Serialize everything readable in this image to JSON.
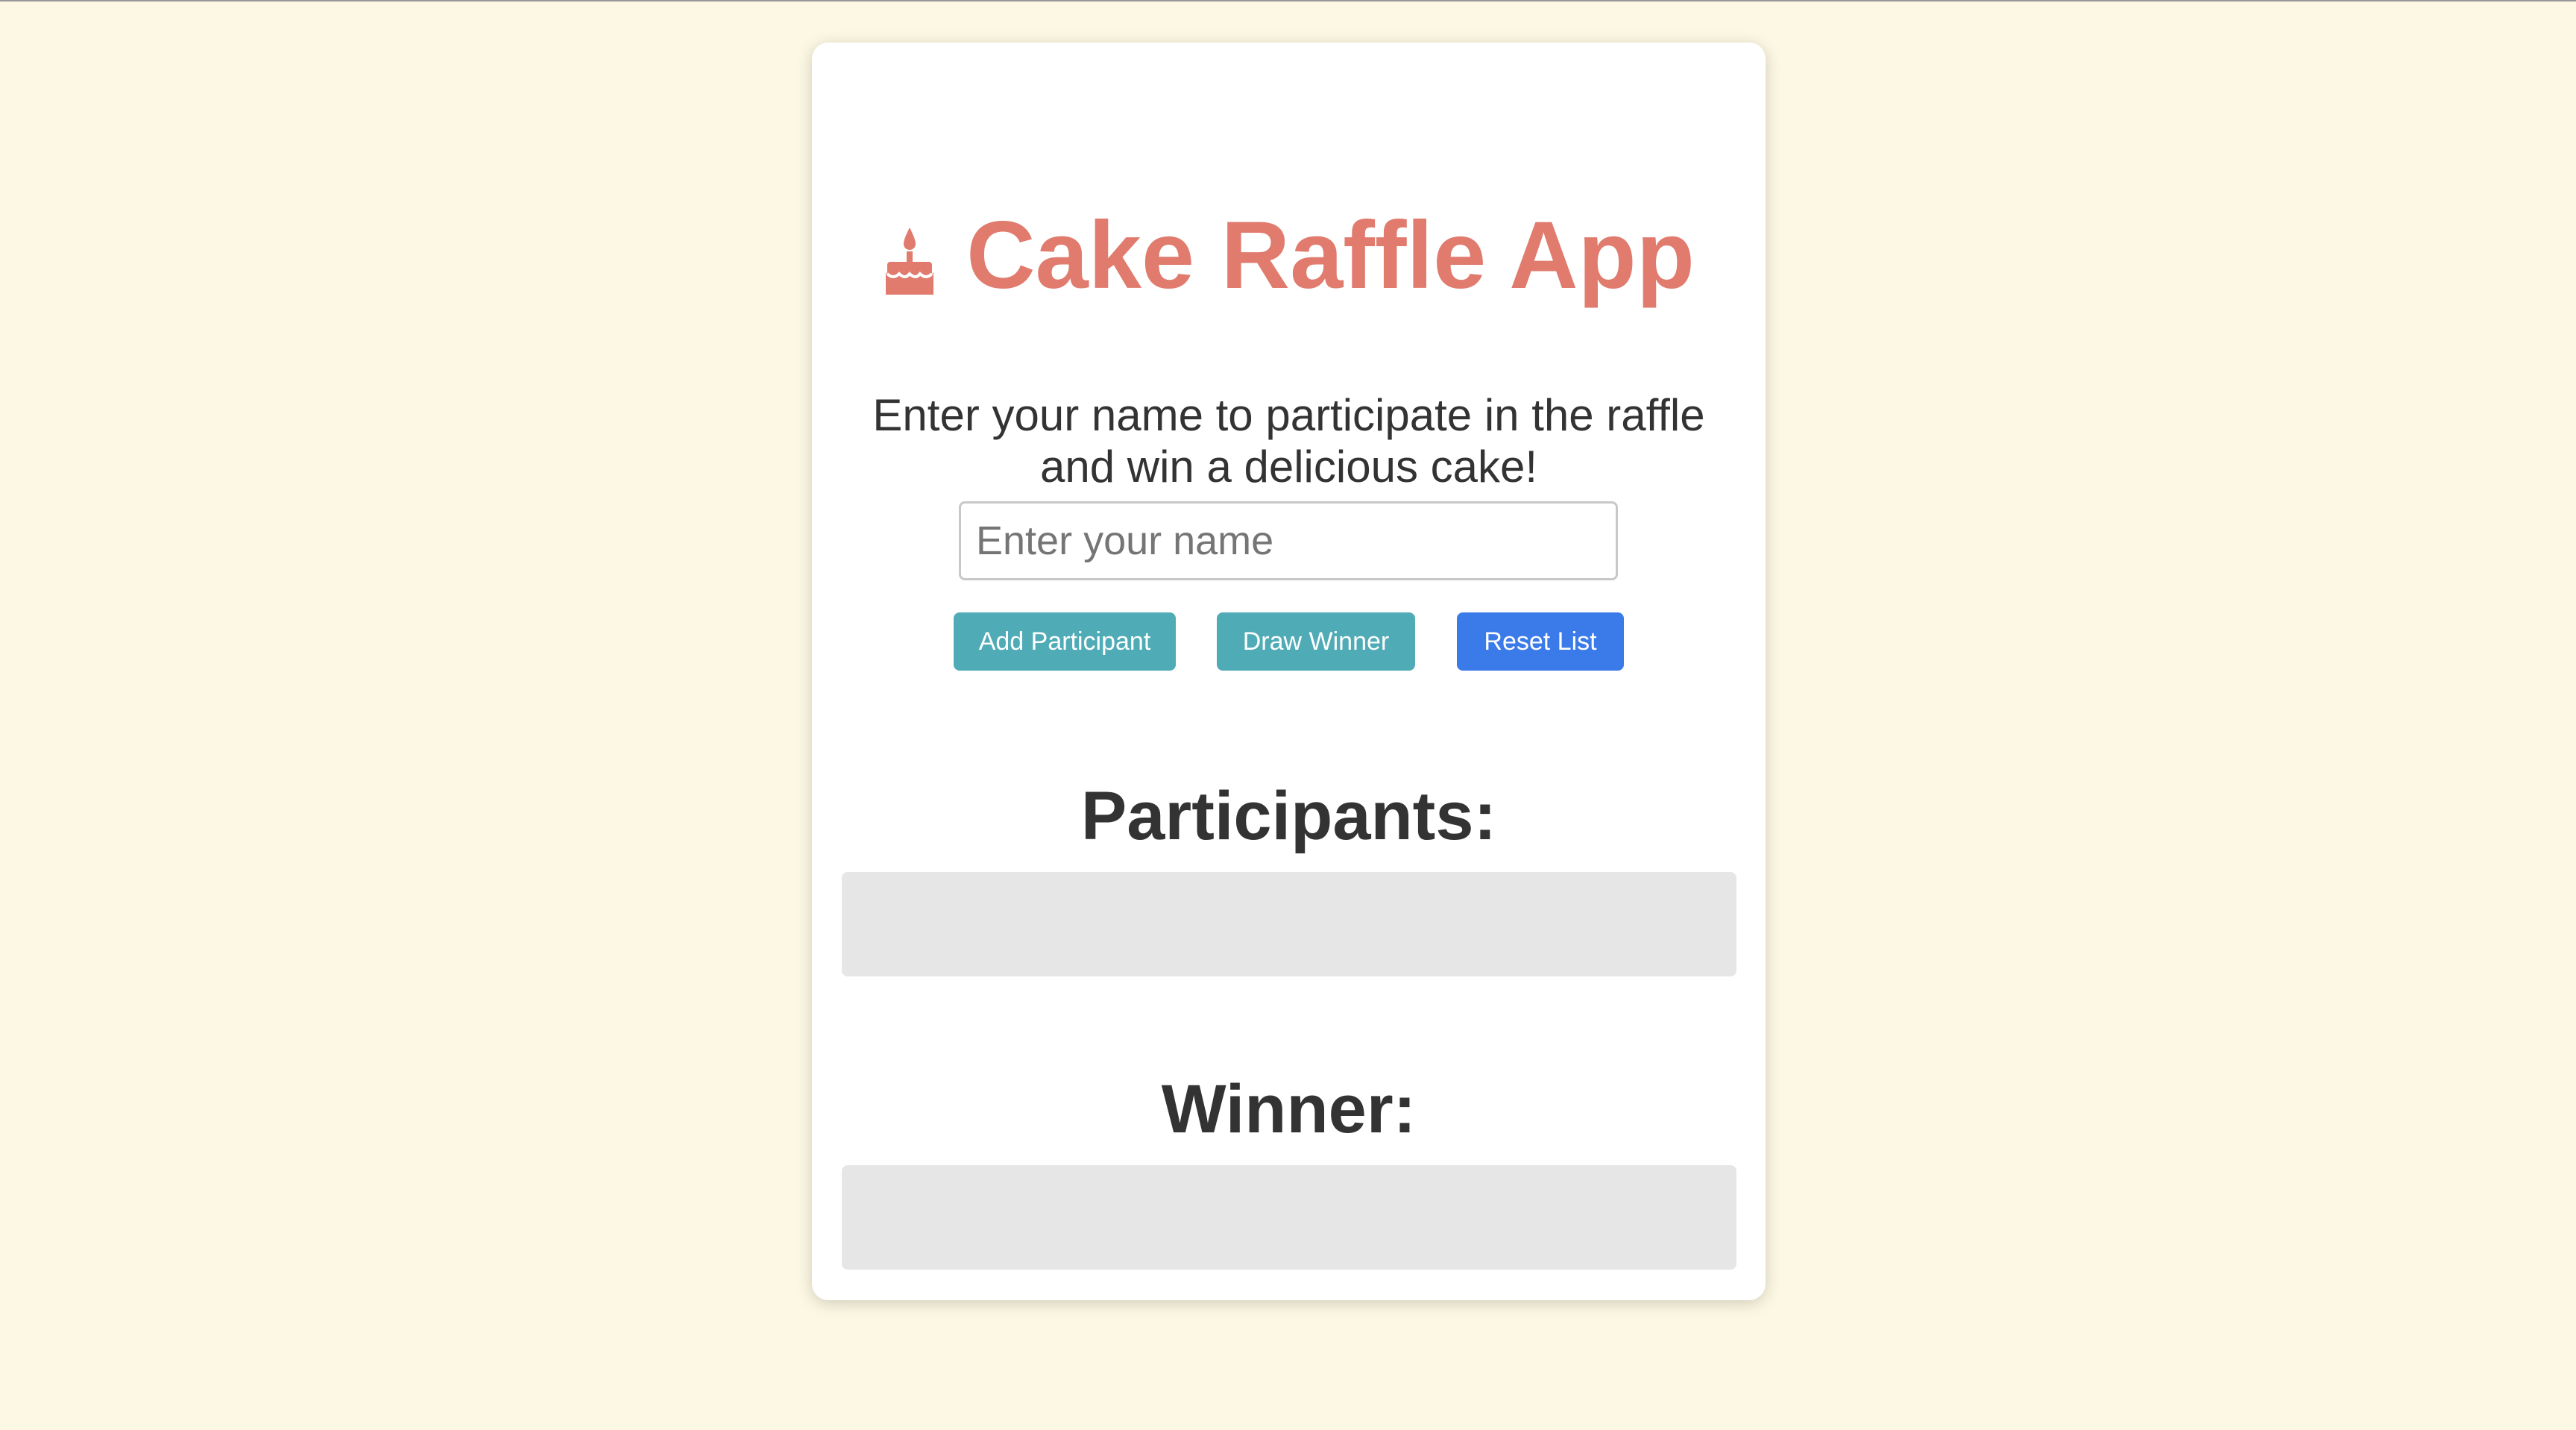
{
  "app": {
    "title": "Cake Raffle App",
    "title_icon": "cake-icon",
    "subtitle": "Enter your name to participate in the raffle and win a delicious cake!"
  },
  "form": {
    "name_placeholder": "Enter your name",
    "name_value": ""
  },
  "buttons": {
    "add_label": "Add Participant",
    "draw_label": "Draw Winner",
    "reset_label": "Reset List"
  },
  "sections": {
    "participants_heading": "Participants:",
    "winner_heading": "Winner:"
  },
  "colors": {
    "background": "#fcf8e3",
    "title": "#e07b6e",
    "teal_button": "#4fabb6",
    "blue_button": "#3b7ae9",
    "empty_box": "#e6e6e6"
  }
}
